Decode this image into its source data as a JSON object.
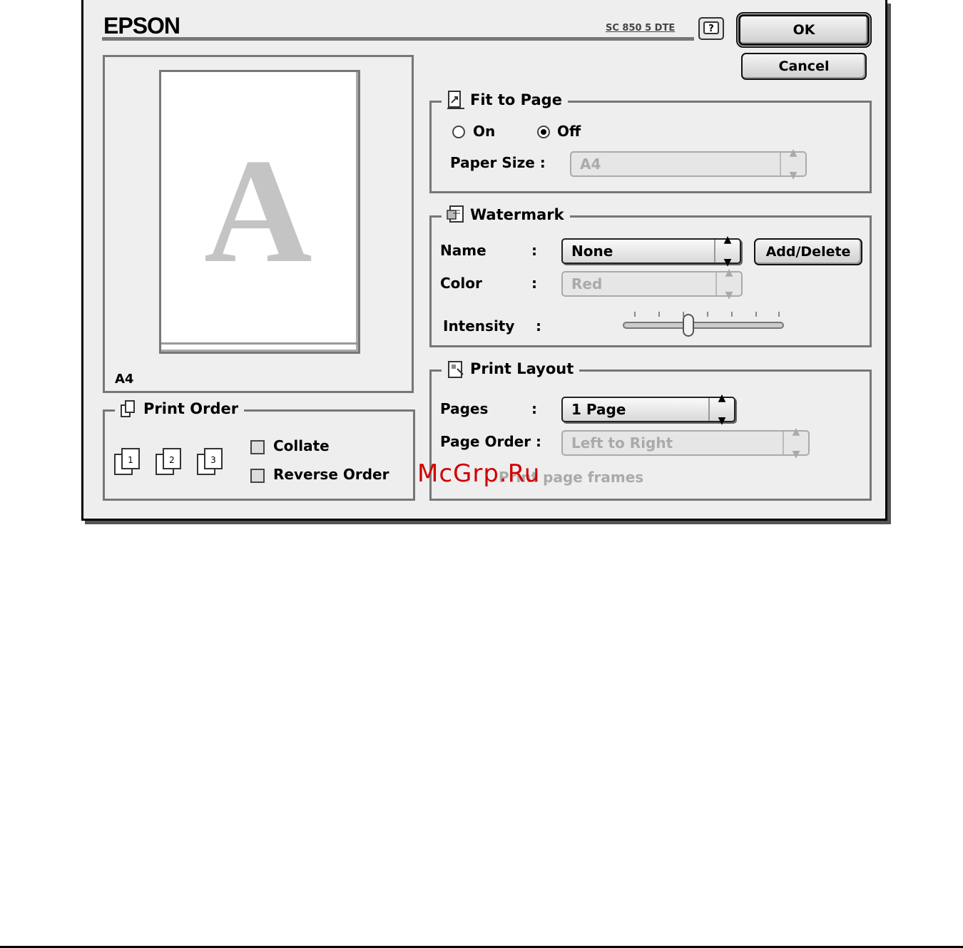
{
  "header": {
    "brand": "EPSON",
    "model": "SC 850 5 DTE"
  },
  "buttons": {
    "ok": "OK",
    "cancel": "Cancel",
    "add_delete": "Add/Delete"
  },
  "preview": {
    "page_letter": "A",
    "paper_label": "A4"
  },
  "print_order": {
    "title": "Print Order",
    "collate": "Collate",
    "reverse_order": "Reverse Order",
    "icons": [
      "1",
      "2",
      "3"
    ]
  },
  "fit_to_page": {
    "title": "Fit to Page",
    "on": "On",
    "off": "Off",
    "selected": "Off",
    "paper_size_label": "Paper Size :",
    "paper_size_value": "A4"
  },
  "watermark": {
    "title": "Watermark",
    "name_label": "Name",
    "name_colon": ":",
    "name_value": "None",
    "color_label": "Color",
    "color_colon": ":",
    "color_value": "Red",
    "intensity_label": "Intensity",
    "intensity_colon": ":",
    "intensity_level": 0.4
  },
  "print_layout": {
    "title": "Print Layout",
    "pages_label": "Pages",
    "pages_colon": ":",
    "pages_value": "1 Page",
    "page_order_label": "Page Order :",
    "page_order_value": "Left to Right",
    "frames_label": "Print page frames"
  },
  "overlay_watermark": "McGrp.Ru"
}
